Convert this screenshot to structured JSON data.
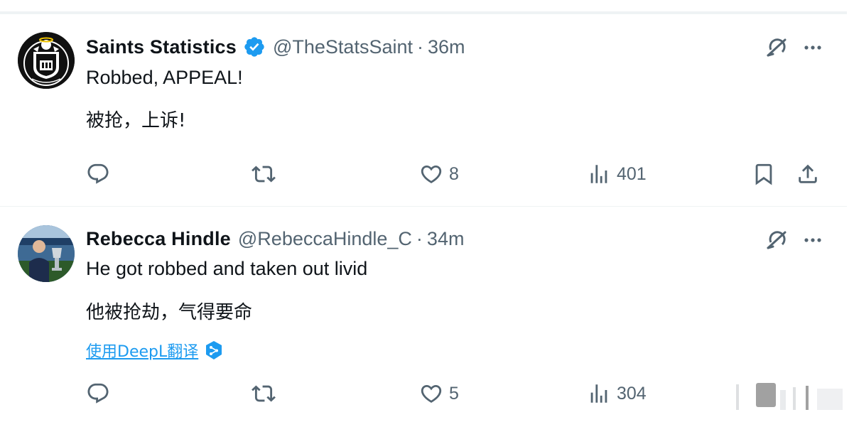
{
  "tweets": [
    {
      "display_name": "Saints Statistics",
      "verified": true,
      "handle": "@TheStatsSaint",
      "separator": "·",
      "time": "36m",
      "text": "Robbed, APPEAL!",
      "translation": "被抢，上诉!",
      "avatar_icon": "saints-crest-avatar",
      "reply_count": "",
      "retweet_count": "",
      "like_count": "8",
      "view_count": "401"
    },
    {
      "display_name": "Rebecca Hindle",
      "verified": false,
      "handle": "@RebeccaHindle_C",
      "separator": "·",
      "time": "34m",
      "text": "He got robbed and taken out livid",
      "translation": "他被抢劫，气得要命",
      "translate_link": "使用DeepL翻译",
      "avatar_icon": "photo-avatar",
      "reply_count": "",
      "retweet_count": "",
      "like_count": "5",
      "view_count": "304"
    }
  ],
  "colors": {
    "text_primary": "#0f1419",
    "text_secondary": "#536471",
    "accent": "#1d9bf0",
    "divider": "#eff3f4"
  }
}
